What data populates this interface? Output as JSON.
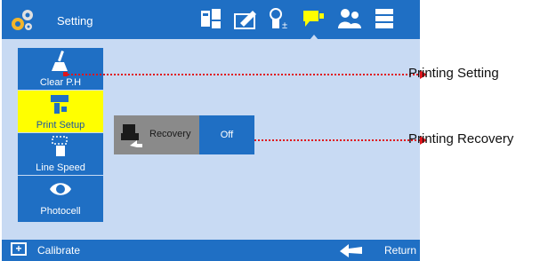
{
  "header": {
    "title": "Setting"
  },
  "menu": {
    "items": [
      {
        "label": "Clear P.H"
      },
      {
        "label": "Print Setup"
      },
      {
        "label": "Line Speed"
      },
      {
        "label": "Photocell"
      }
    ]
  },
  "recovery": {
    "label": "Recovery",
    "value": "Off"
  },
  "footer": {
    "calibrate": "Calibrate",
    "return": "Return"
  },
  "annotations": {
    "printing_setting": "Printing Setting",
    "printing_recovery": "Printing Recovery"
  },
  "colors": {
    "accent": "#1f6fc4",
    "selected": "#ffff00",
    "background": "#c8daf3",
    "callout": "#e0151b"
  }
}
